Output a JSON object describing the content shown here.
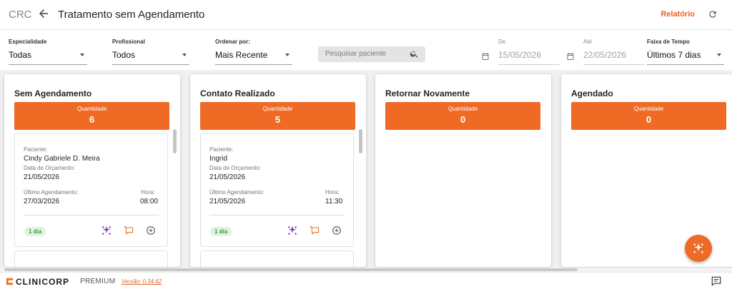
{
  "header": {
    "app": "CRC",
    "title": "Tratamento sem Agendamento",
    "report_label": "Relatório"
  },
  "filters": {
    "especialidade": {
      "label": "Especialidade",
      "value": "Todas"
    },
    "profissional": {
      "label": "Profissional",
      "value": "Todos"
    },
    "ordenar": {
      "label": "Ordenar por:",
      "value": "Mais Recente"
    },
    "search_placeholder": "Pesquisar paciente",
    "de": {
      "label": "De",
      "value": "15/05/2026"
    },
    "ate": {
      "label": "Até",
      "value": "22/05/2026"
    },
    "faixa": {
      "label": "Faixa de Tempo",
      "value": "Últimos 7 dias"
    }
  },
  "columns": [
    {
      "title": "Sem Agendamento",
      "quantity_label": "Quantidade",
      "quantity": "6",
      "card": {
        "patient_label": "Paciente:",
        "patient": "Cindy Gabriele D. Meira",
        "budget_date_label": "Data de Orçamento:",
        "budget_date": "21/05/2026",
        "last_label": "Último Agendamento:",
        "last": "27/03/2026",
        "hour_label": "Hora:",
        "hour": "08:00",
        "badge": "1 dia"
      }
    },
    {
      "title": "Contato Realizado",
      "quantity_label": "Quantidade",
      "quantity": "5",
      "card": {
        "patient_label": "Paciente:",
        "patient": "Ingrid",
        "budget_date_label": "Data de Orçamento:",
        "budget_date": "21/05/2026",
        "last_label": "Último Agendamento:",
        "last": "21/05/2026",
        "hour_label": "Hora:",
        "hour": "11:30",
        "badge": "1 dia"
      }
    },
    {
      "title": "Retornar Novamente",
      "quantity_label": "Quantidade",
      "quantity": "0"
    },
    {
      "title": "Agendado",
      "quantity_label": "Quantidade",
      "quantity": "0"
    }
  ],
  "footer": {
    "brand": "CLINICORP",
    "plan": "PREMIUM",
    "version": "Versão: 0.34.62"
  },
  "colors": {
    "accent": "#ee6a25",
    "badge_bg": "#dff3de",
    "badge_text": "#3f9a3d",
    "ai_icon": "#7b2cbf"
  },
  "icons": [
    "back-arrow-icon",
    "refresh-icon",
    "search-icon",
    "calendar-icon",
    "sparkle-icon",
    "message-icon",
    "add-circle-icon",
    "chat-icon"
  ]
}
